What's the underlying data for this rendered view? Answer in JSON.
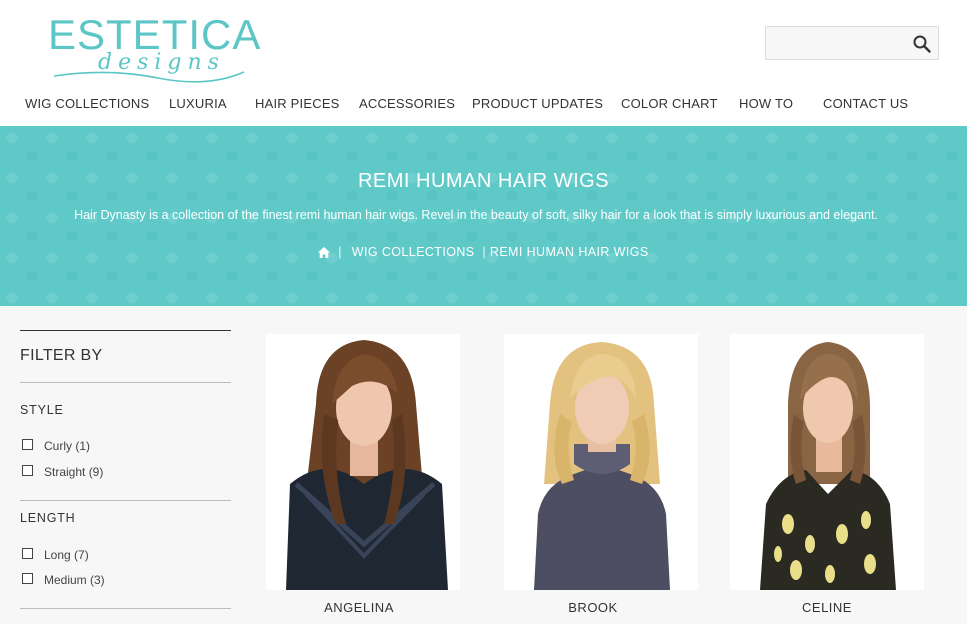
{
  "brand": {
    "name": "ESTETICA",
    "tagline": "designs",
    "color": "#5cc6c6"
  },
  "search": {
    "placeholder": "",
    "value": "",
    "icon": "search-icon"
  },
  "nav": {
    "items": [
      {
        "label": "WIG COLLECTIONS"
      },
      {
        "label": "LUXURIA"
      },
      {
        "label": "HAIR PIECES"
      },
      {
        "label": "ACCESSORIES"
      },
      {
        "label": "PRODUCT UPDATES"
      },
      {
        "label": "COLOR CHART"
      },
      {
        "label": "HOW TO"
      },
      {
        "label": "CONTACT US"
      }
    ]
  },
  "banner": {
    "title": "REMI HUMAN HAIR WIGS",
    "description": "Hair Dynasty is a collection of the finest remi human hair wigs. Revel in the beauty of soft, silky hair for a look that is simply luxurious and elegant.",
    "background_color": "#5fc9c8",
    "breadcrumb": {
      "home_icon": "home-icon",
      "items": [
        "WIG COLLECTIONS",
        "REMI HUMAN HAIR WIGS"
      ]
    }
  },
  "filters": {
    "title": "FILTER BY",
    "groups": [
      {
        "title": "STYLE",
        "options": [
          {
            "label": "Curly (1)",
            "checked": false
          },
          {
            "label": "Straight (9)",
            "checked": false
          }
        ]
      },
      {
        "title": "LENGTH",
        "options": [
          {
            "label": "Long (7)",
            "checked": false
          },
          {
            "label": "Medium (3)",
            "checked": false
          }
        ]
      }
    ]
  },
  "products": [
    {
      "name": "ANGELINA",
      "hair_color": "#6b4226",
      "outfit_color": "#1f2733"
    },
    {
      "name": "BROOK",
      "hair_color": "#e2c27e",
      "outfit_color": "#4d4e62"
    },
    {
      "name": "CELINE",
      "hair_color": "#8a6544",
      "outfit_color": "#2b2a22"
    }
  ]
}
